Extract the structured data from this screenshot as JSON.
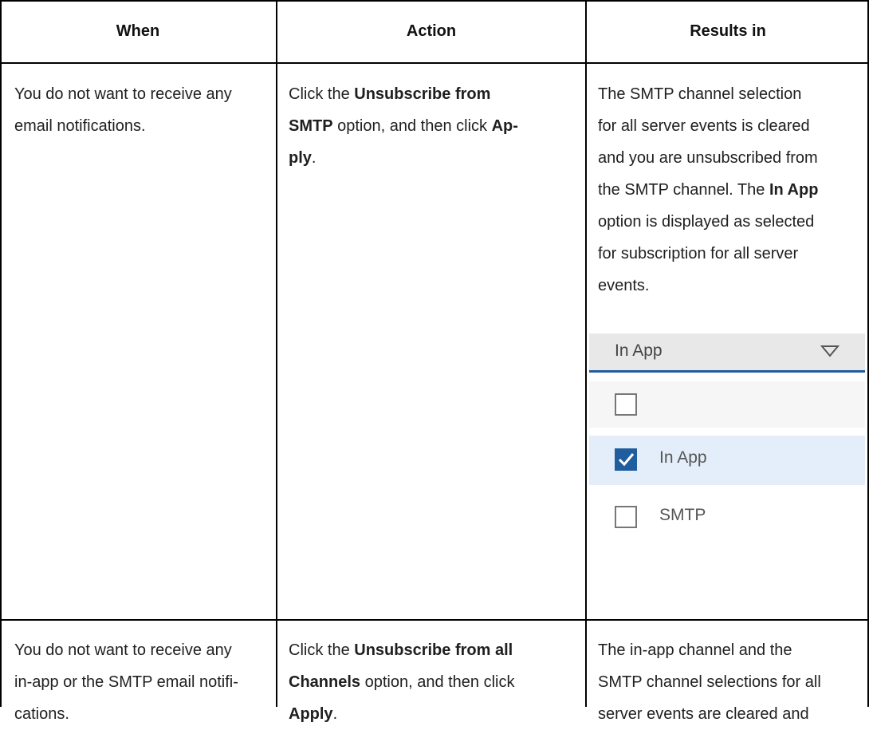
{
  "table": {
    "headers": [
      "When",
      "Action",
      "Results in"
    ],
    "rows": [
      {
        "when": [
          "You do not want to receive any",
          "email notifications."
        ],
        "action_lines": [
          [
            {
              "t": "Click the ",
              "b": false
            },
            {
              "t": "Unsubscribe from",
              "b": true
            }
          ],
          [
            {
              "t": "SMTP",
              "b": true
            },
            {
              "t": " option, and then click ",
              "b": false
            },
            {
              "t": "Ap-",
              "b": true
            }
          ],
          [
            {
              "t": "ply",
              "b": true
            },
            {
              "t": ".",
              "b": false
            }
          ]
        ],
        "result_lines": [
          [
            {
              "t": "The SMTP channel selection",
              "b": false
            }
          ],
          [
            {
              "t": "for all server events is cleared",
              "b": false
            }
          ],
          [
            {
              "t": "and you are unsubscribed from",
              "b": false
            }
          ],
          [
            {
              "t": "the SMTP channel. The ",
              "b": false
            },
            {
              "t": "In App",
              "b": true
            }
          ],
          [
            {
              "t": "option is displayed as selected",
              "b": false
            }
          ],
          [
            {
              "t": "for subscription for all server",
              "b": false
            }
          ],
          [
            {
              "t": "events.",
              "b": false
            }
          ]
        ],
        "widget": {
          "selected_value": "In App",
          "options": [
            {
              "label": "",
              "checked": false
            },
            {
              "label": "In App",
              "checked": true
            },
            {
              "label": "SMTP",
              "checked": false
            }
          ]
        }
      },
      {
        "when": [
          "You do not want to receive any",
          "in-app or the SMTP email notifi-",
          "cations."
        ],
        "action_lines": [
          [
            {
              "t": "Click the ",
              "b": false
            },
            {
              "t": "Unsubscribe from all",
              "b": true
            }
          ],
          [
            {
              "t": "Channels",
              "b": true
            },
            {
              "t": " option, and then click",
              "b": false
            }
          ],
          [
            {
              "t": "Apply",
              "b": true
            },
            {
              "t": ".",
              "b": false
            }
          ]
        ],
        "result_lines": [
          [
            {
              "t": "The in-app channel and the",
              "b": false
            }
          ],
          [
            {
              "t": "SMTP channel selections for all",
              "b": false
            }
          ],
          [
            {
              "t": "server events are cleared and",
              "b": false
            }
          ]
        ]
      }
    ]
  },
  "colors": {
    "border": "#000000",
    "accent": "#1f5d9e",
    "selected_bg": "#e3eefa"
  },
  "icons": {
    "dropdown": "triangle-down-icon",
    "check": "checkmark-icon"
  }
}
